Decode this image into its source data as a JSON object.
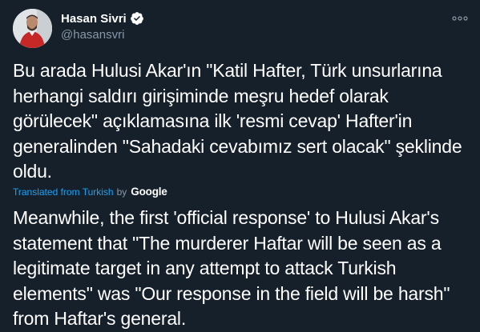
{
  "author": {
    "name": "Hasan Sivri",
    "handle": "@hasansvri",
    "verified": true,
    "avatar_icon": "profile-photo-person-red-shirt"
  },
  "menu": {
    "icon": "more-dots-icon"
  },
  "tweet": {
    "lines": [
      "Bu arada Hulusi Akar'ın \"Katil Hafter, Türk unsurlarına",
      "herhangi saldırı girişiminde meşru hedef olarak",
      "görülecek\" açıklamasına ilk 'resmi cevap' Hafter'in",
      "generalinden \"Sahadaki cevabımız sert olacak\" şeklinde",
      "oldu."
    ]
  },
  "translation": {
    "label": "Translated from Turkish",
    "by": "by",
    "provider": "Google",
    "lines": [
      "Meanwhile, the first 'official response' to Hulusi Akar's",
      "statement that \"The murderer Haftar will be seen as a",
      "legitimate target in any attempt to attack Turkish",
      "elements\" was \"Our response in the field will be harsh\"",
      "from Haftar's general."
    ]
  },
  "colors": {
    "background": "#15202b",
    "text": "#ffffff",
    "secondary": "#8899a6",
    "accent": "#1da1f2"
  }
}
